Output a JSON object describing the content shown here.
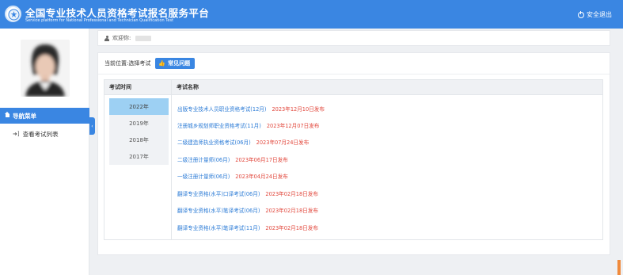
{
  "header": {
    "title_cn": "全国专业技术人员资格考试报名服务平台",
    "title_en": "Service platform for National Professional and Technician Qualification Test",
    "logout_label": "安全退出",
    "logout_icon": "power-icon",
    "emblem_icon": "national-emblem-icon"
  },
  "sidebar": {
    "nav_header_label": "导航菜单",
    "nav_header_icon": "home-icon",
    "items": [
      {
        "label": "查看考试列表",
        "icon": "sign-in-icon"
      }
    ],
    "collapse_glyph": "‹"
  },
  "welcome": {
    "label": "欢迎你:",
    "icon": "user-icon"
  },
  "breadcrumb": {
    "prefix": "当前位置:",
    "current": "选择考试"
  },
  "faq_button": {
    "label": "常见问题",
    "icon": "thumbs-up-icon"
  },
  "table": {
    "col_time": "考试时间",
    "col_name": "考试名称",
    "years": [
      "2022年",
      "2019年",
      "2018年",
      "2017年"
    ],
    "selected_year": "2022年",
    "exams": [
      {
        "name": "出版专业技术人员职业资格考试(12月)",
        "date": "2023年12月10日发布"
      },
      {
        "name": "注册城乡规划师职业资格考试(11月)",
        "date": "2023年12月07日发布"
      },
      {
        "name": "二级建造师执业资格考试(06月)",
        "date": "2023年07月24日发布"
      },
      {
        "name": "二级注册计量师(06月)",
        "date": "2023年06月17日发布"
      },
      {
        "name": "一级注册计量师(06月)",
        "date": "2023年04月24日发布"
      },
      {
        "name": "翻译专业资格(水平)口译考试(06月)",
        "date": "2023年02月18日发布"
      },
      {
        "name": "翻译专业资格(水平)笔译考试(06月)",
        "date": "2023年02月18日发布"
      },
      {
        "name": "翻译专业资格(水平)笔译考试(11月)",
        "date": "2023年02月18日发布"
      }
    ]
  },
  "colors": {
    "brand_blue": "#3a86e2",
    "link_blue": "#2b7bd6",
    "date_red": "#e2483d",
    "selected_year_bg": "#9dd0f3"
  }
}
